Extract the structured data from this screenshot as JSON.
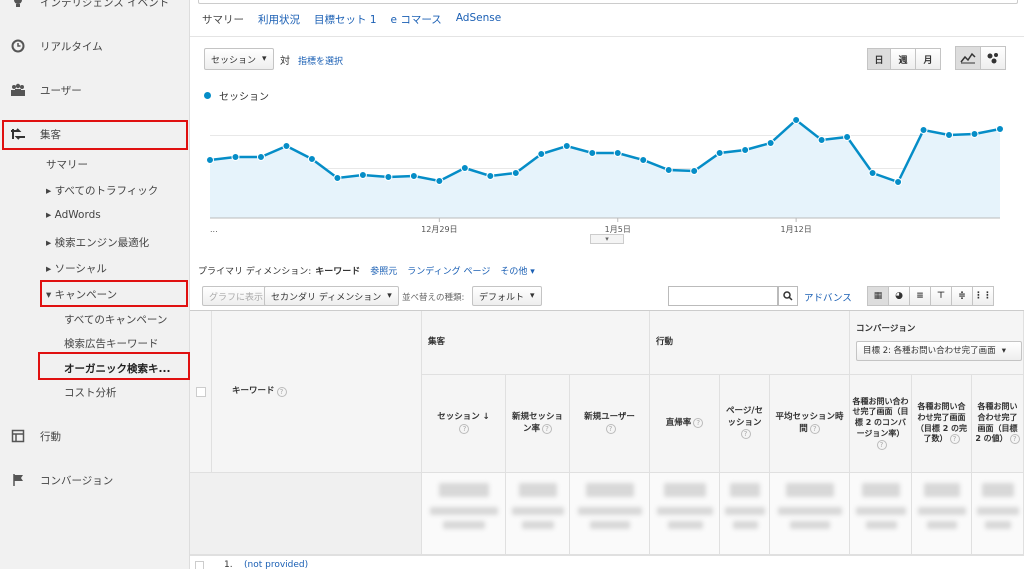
{
  "sidebar": {
    "items": [
      {
        "label": "インテリジェンス イベント",
        "icon": "lightbulb-icon"
      },
      {
        "label": "リアルタイム",
        "icon": "clock-icon"
      },
      {
        "label": "ユーザー",
        "icon": "users-icon"
      },
      {
        "label": "集客",
        "icon": "acquisition-icon"
      },
      {
        "label": "行動",
        "icon": "behavior-icon"
      },
      {
        "label": "コンバージョン",
        "icon": "flag-icon"
      }
    ],
    "acquisition_sub": [
      "サマリー",
      "▸ すべてのトラフィック",
      "▸ AdWords",
      "▸ 検索エンジン最適化",
      "▸ ソーシャル",
      "▾ キャンペーン"
    ],
    "campaign_sub": [
      "すべてのキャンペーン",
      "検索広告キーワード",
      "オーガニック検索キ...",
      "コスト分析"
    ]
  },
  "tabs": [
    "サマリー",
    "利用状況",
    "目標セット 1",
    "e コマース",
    "AdSense"
  ],
  "metric_select": {
    "label": "セッション",
    "vs": "対",
    "pick": "指標を選択"
  },
  "period_buttons": [
    "日",
    "週",
    "月"
  ],
  "legend_label": "セッション",
  "chart_data": {
    "type": "line",
    "series": [
      {
        "name": "セッション",
        "values": [
          58,
          61,
          61,
          72,
          59,
          40,
          43,
          41,
          42,
          37,
          50,
          42,
          45,
          64,
          72,
          65,
          65,
          58,
          48,
          47,
          65,
          68,
          75,
          98,
          78,
          81,
          45,
          36,
          88,
          83,
          84,
          89
        ]
      }
    ],
    "x_tick_labels": [
      "...",
      "12月29日",
      "1月5日",
      "1月12日"
    ],
    "ylim": [
      0,
      110
    ],
    "grid": true,
    "colors": {
      "line": "#058dc7",
      "fill": "#e6f3fb"
    }
  },
  "primary_dimension": {
    "label": "プライマリ ディメンション:",
    "current": "キーワード",
    "options": [
      "参照元",
      "ランディング ページ",
      "その他"
    ]
  },
  "toolbar": {
    "graph_btn": "グラフに表示",
    "secondary": "セカンダリ ディメンション",
    "sort_label": "並べ替えの種類:",
    "sort_value": "デフォルト",
    "advanced": "アドバンス"
  },
  "table": {
    "col_keyword": "キーワード",
    "groups": [
      "集客",
      "行動",
      "コンバージョン"
    ],
    "goal_select": "目標 2: 各種お問い合わせ完了画面",
    "headers": [
      "セッション",
      "新規セッション率",
      "新規ユーザー",
      "直帰率",
      "ページ/セッション",
      "平均セッション時間",
      "各種お問い合わせ完了画面（目標 2 のコンバージョン率）",
      "各種お問い合わせ完了画面（目標 2 の完了数）",
      "各種お問い合わせ完了画面（目標 2 の値）"
    ],
    "row1_index": "1.",
    "row1_keyword": "(not provided)"
  }
}
